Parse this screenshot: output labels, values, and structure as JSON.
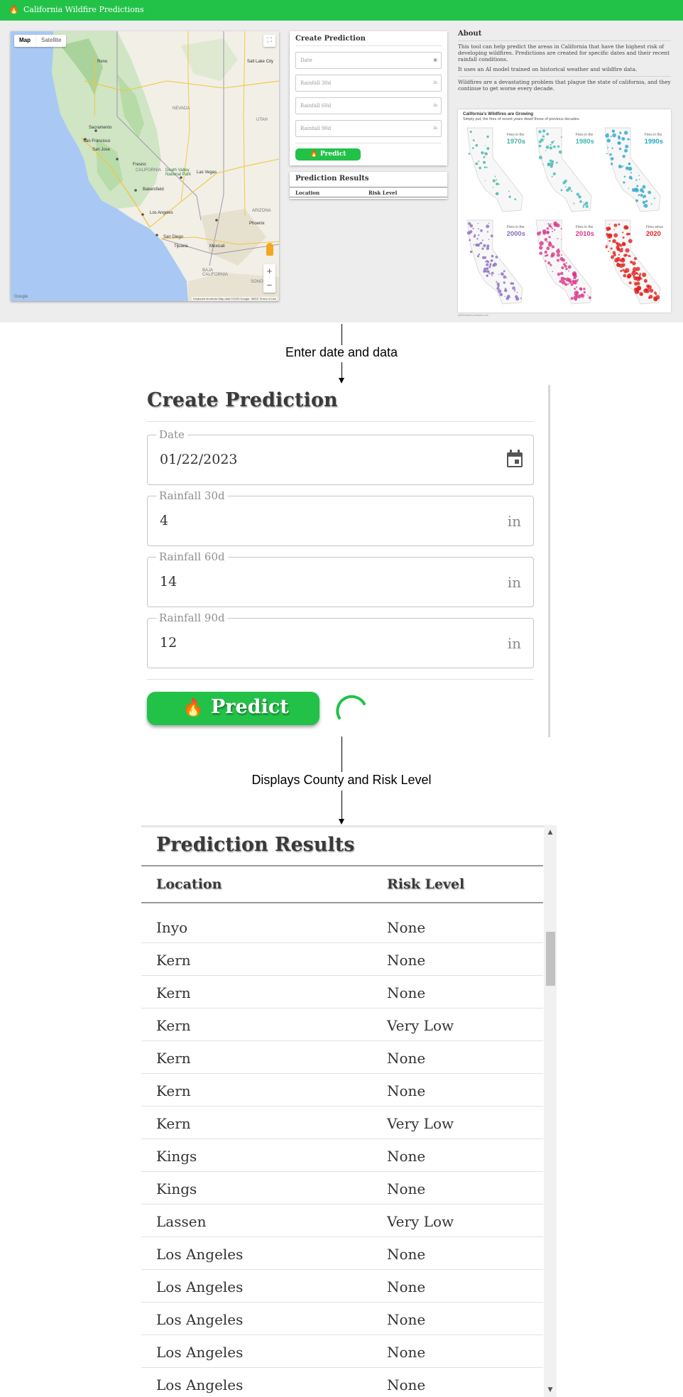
{
  "app": {
    "title": "California Wildfire Predictions",
    "accent_color": "#22c248",
    "map": {
      "type_buttons": [
        "Map",
        "Satellite"
      ],
      "labels": [
        "Reno",
        "NEVADA",
        "Sacramento",
        "San Francisco",
        "San Jose",
        "Fresno",
        "CALIFORNIA",
        "Death Valley National Park",
        "Las Vegas",
        "Bakersfield",
        "Los Angeles",
        "San Diego",
        "Tijuana",
        "ARIZONA",
        "Phoenix",
        "BAJA CALIFORNIA",
        "UTAH",
        "Salt Lake City",
        "Mexicali",
        "SONORA"
      ],
      "google_mark": "Google",
      "terms": "Keyboard shortcuts  Map data ©2023 Google, INEGI  Terms of Use",
      "zoom_in": "+",
      "zoom_out": "−",
      "fullscreen_icon": "fullscreen-icon"
    },
    "mini_create": {
      "title": "Create Prediction",
      "fields": [
        {
          "label": "Date",
          "unit": ""
        },
        {
          "label": "Rainfall 30d",
          "unit": "in"
        },
        {
          "label": "Rainfall 60d",
          "unit": "in"
        },
        {
          "label": "Rainfall 90d",
          "unit": "in"
        }
      ],
      "button": "Predict"
    },
    "mini_results": {
      "title": "Prediction Results",
      "col_location": "Location",
      "col_risk": "Risk Level"
    },
    "about": {
      "title": "About",
      "p1": "This tool can help predict the areas in California that have the highest risk of developing wildfires. Predictions are created for specific dates and their recent rainfall conditions.",
      "p2": "It uses an AI model trained on historical weather and wildfire data.",
      "p3": "Wildfires are a devastating problem that plague the state of california, and they continue to get worse every decade.",
      "infographic_title": "California's Wildfires are Growing",
      "infographic_subtitle": "Simply put, the fires of recent years dwarf those of previous decades.",
      "decades": [
        {
          "small": "Fires in the",
          "big": "1970s",
          "color": "#45b0a5"
        },
        {
          "small": "Fires in the",
          "big": "1980s",
          "color": "#3fb8b8"
        },
        {
          "small": "Fires in the",
          "big": "1990s",
          "color": "#2aa8c9"
        },
        {
          "small": "Fires in the",
          "big": "2000s",
          "color": "#8a6cc0"
        },
        {
          "small": "Fires in the",
          "big": "2010s",
          "color": "#d8378a"
        },
        {
          "small": "Fires since",
          "big": "2020",
          "color": "#e0201e"
        }
      ],
      "source": "wildfirehistory.example.com"
    }
  },
  "flow": {
    "step1": "Enter date and data",
    "step2": "Displays County and Risk Level"
  },
  "create": {
    "title": "Create Prediction",
    "date": {
      "label": "Date",
      "value": "01/22/2023",
      "icon": "calendar-icon"
    },
    "rain30": {
      "label": "Rainfall 30d",
      "value": "4",
      "unit": "in"
    },
    "rain60": {
      "label": "Rainfall 60d",
      "value": "14",
      "unit": "in"
    },
    "rain90": {
      "label": "Rainfall 90d",
      "value": "12",
      "unit": "in"
    },
    "button": "Predict",
    "flame_icon": "🔥"
  },
  "results": {
    "title": "Prediction Results",
    "col_location": "Location",
    "col_risk": "Risk Level",
    "rows": [
      {
        "location": "Inyo",
        "risk": "None"
      },
      {
        "location": "Kern",
        "risk": "None"
      },
      {
        "location": "Kern",
        "risk": "None"
      },
      {
        "location": "Kern",
        "risk": "Very Low"
      },
      {
        "location": "Kern",
        "risk": "None"
      },
      {
        "location": "Kern",
        "risk": "None"
      },
      {
        "location": "Kern",
        "risk": "Very Low"
      },
      {
        "location": "Kings",
        "risk": "None"
      },
      {
        "location": "Kings",
        "risk": "None"
      },
      {
        "location": "Lassen",
        "risk": "Very Low"
      },
      {
        "location": "Los Angeles",
        "risk": "None"
      },
      {
        "location": "Los Angeles",
        "risk": "None"
      },
      {
        "location": "Los Angeles",
        "risk": "None"
      },
      {
        "location": "Los Angeles",
        "risk": "None"
      },
      {
        "location": "Los Angeles",
        "risk": "None"
      }
    ],
    "scroll_up": "▲",
    "scroll_down": "▼"
  }
}
